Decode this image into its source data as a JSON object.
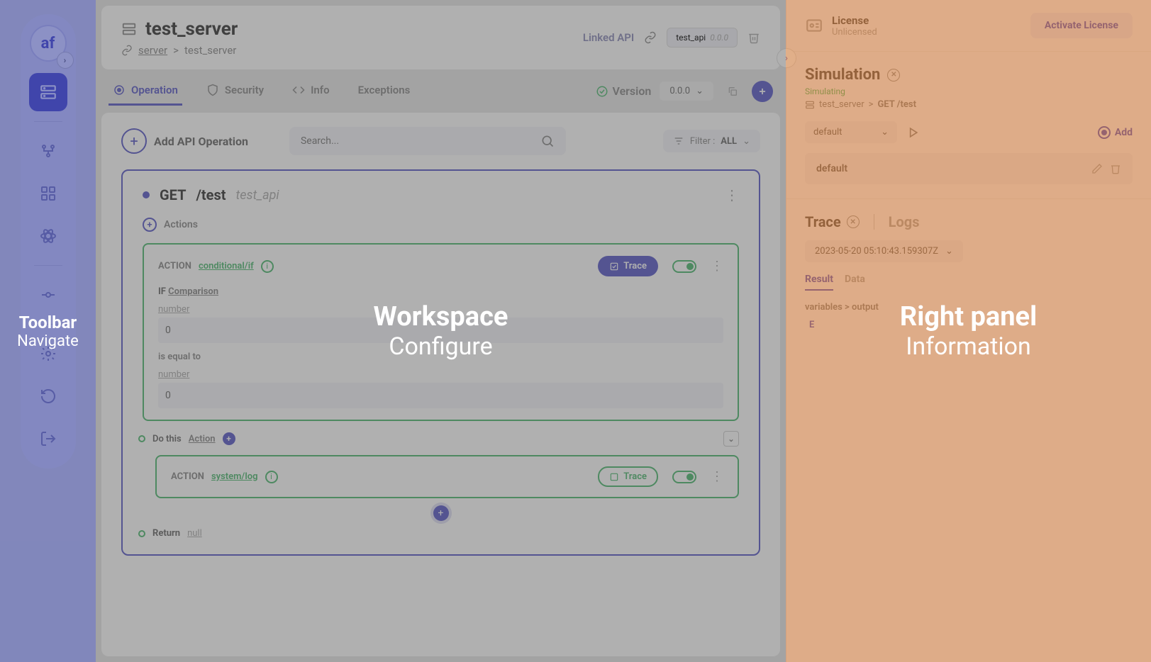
{
  "toolbar": {
    "logo": "af"
  },
  "header": {
    "title": "test_server",
    "breadcrumb_root": "server",
    "breadcrumb_sep": ">",
    "breadcrumb_current": "test_server",
    "linked_api_label": "Linked API",
    "api_name": "test_api",
    "api_version": "0.0.0"
  },
  "tabs": {
    "operation": "Operation",
    "security": "Security",
    "info": "Info",
    "exceptions": "Exceptions",
    "version_label": "Version",
    "version_value": "0.0.0"
  },
  "content": {
    "add_operation": "Add API Operation",
    "search_placeholder": "Search...",
    "filter_label": "Filter :",
    "filter_value": "ALL"
  },
  "operation": {
    "method": "GET",
    "path": "/test",
    "api": "test_api",
    "actions_label": "Actions",
    "action1": {
      "label": "ACTION",
      "link": "conditional/if",
      "trace": "Trace",
      "if_label": "IF",
      "if_link": "Comparison",
      "field1_label": "number",
      "field1_value": "0",
      "op_text": "is equal to",
      "field2_label": "number",
      "field2_value": "0"
    },
    "do_this": "Do this",
    "do_this_link": "Action",
    "action2": {
      "label": "ACTION",
      "link": "system/log",
      "trace": "Trace"
    },
    "return_label": "Return",
    "return_value": "null"
  },
  "right": {
    "license_title": "License",
    "license_status": "Unlicensed",
    "activate": "Activate License",
    "sim_title": "Simulation",
    "sim_status": "Simulating",
    "sim_server": "test_server",
    "sim_sep": ">",
    "sim_endpoint": "GET /test",
    "sim_dropdown": "default",
    "sim_add": "Add",
    "sim_item": "default",
    "trace_tab": "Trace",
    "logs_tab": "Logs",
    "timestamp": "2023-05-20 05:10:43.159307Z",
    "result_tab": "Result",
    "data_tab": "Data",
    "vars_path": "variables > output",
    "collapse": "E"
  },
  "overlays": {
    "toolbar_title": "Toolbar",
    "toolbar_sub": "Navigate",
    "workspace_title": "Workspace",
    "workspace_sub": "Configure",
    "right_title": "Right panel",
    "right_sub": "Information"
  }
}
